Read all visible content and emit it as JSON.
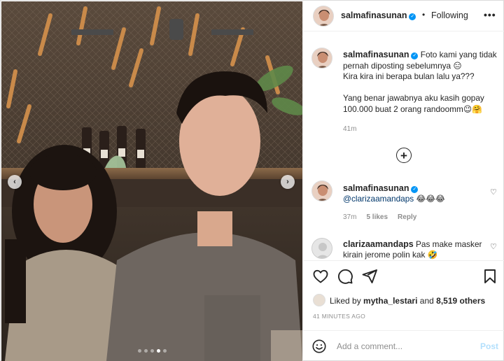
{
  "post": {
    "author": "salmafinasunan",
    "follow_status": "Following",
    "dot_separator": "•",
    "more_label": "•••",
    "verified_glyph": "✓"
  },
  "caption": {
    "username": "salmafinasunan",
    "text": "Foto kami yang tidak pernah diposting sebelumnya 😑\nKira kira ini berapa bulan lalu ya???\n\nYang benar jawabnya aku kasih gopay 100.000 buat 2 orang randoomm😉🤗",
    "time": "41m"
  },
  "load_more_icon": "+",
  "comments": [
    {
      "username": "salmafinasunan",
      "mention": "@clarizaamandaps",
      "emojis": "😂😂😂",
      "time": "37m",
      "likes": "5 likes",
      "reply": "Reply"
    },
    {
      "username": "clarizaamandaps",
      "text_line1": "Pas make masker",
      "text_line2": "kirain jerome polin kak 🤣"
    }
  ],
  "heart_glyph": "♡",
  "likes": {
    "prefix": "Liked by",
    "liker": "mytha_lestari",
    "and": "and",
    "others": "8,519 others"
  },
  "posted_time": "41 MINUTES AGO",
  "composer": {
    "placeholder": "Add a comment...",
    "post_label": "Post"
  },
  "carousel": {
    "prev_glyph": "‹",
    "next_glyph": "›",
    "slide_count": 5,
    "active_slide": 4
  },
  "icons": [
    "heart-icon",
    "comment-icon",
    "share-icon",
    "bookmark-icon",
    "emoji-icon",
    "verified-icon",
    "chevron-left-icon",
    "chevron-right-icon",
    "plus-circle-icon"
  ],
  "colors": {
    "verified_blue": "#0095f6",
    "secondary_text": "#8e8e8e",
    "mention_blue": "#00376b",
    "post_disabled": "#b2dffc"
  }
}
